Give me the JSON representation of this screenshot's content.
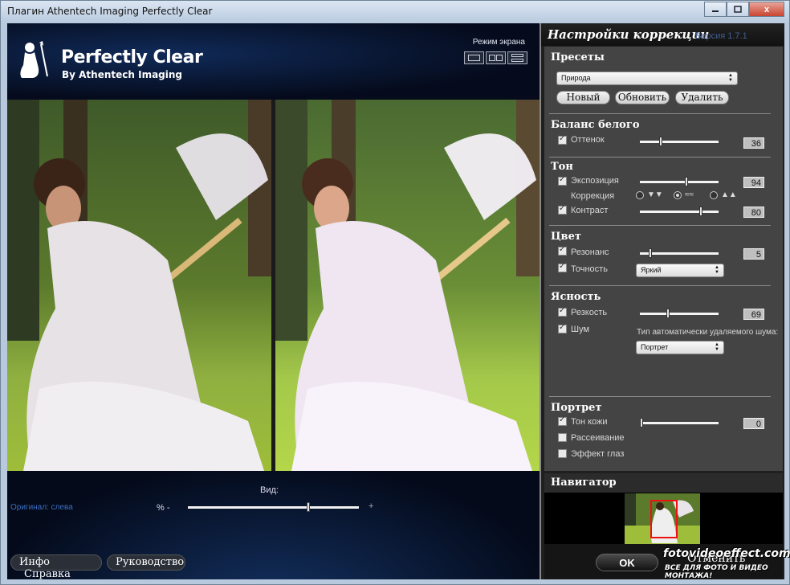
{
  "window": {
    "title": "Плагин Athentech Imaging Perfectly Clear",
    "close": "x"
  },
  "header": {
    "logo_title": "Perfectly Clear",
    "logo_sub": "By Athentech Imaging",
    "mode_label": "Режим экрана"
  },
  "viewbar": {
    "view_label": "Вид:",
    "original_label": "Оригинал: слева",
    "pct_label": "% -",
    "plus_label": "+",
    "view_value": 0.71
  },
  "bottom_buttons": {
    "info": "Инфо",
    "help": "Справка",
    "guide": "Руководство"
  },
  "panel": {
    "title": "Настройки коррекции",
    "version": "Версия 1.7.1"
  },
  "presets": {
    "title": "Пресеты",
    "selected": "Природа",
    "new": "Новый",
    "update": "Обновить",
    "delete": "Удалить"
  },
  "white_balance": {
    "title": "Баланс белого",
    "tint": {
      "label": "Оттенок",
      "value": "36",
      "checked": true,
      "pos": 0.26
    }
  },
  "tone": {
    "title": "Тон",
    "exposure": {
      "label": "Экспозиция",
      "value": "94",
      "checked": true,
      "pos": 0.6
    },
    "correction_label": "Коррекция",
    "radio_low": "▼▼",
    "radio_mid": "≈≈",
    "radio_high": "▲▲",
    "contrast": {
      "label": "Контраст",
      "value": "80",
      "checked": true,
      "pos": 0.79
    }
  },
  "color": {
    "title": "Цвет",
    "resonance": {
      "label": "Резонанс",
      "value": "5",
      "checked": true,
      "pos": 0.12
    },
    "accuracy": {
      "label": "Точность",
      "checked": true,
      "selected": "Яркий"
    }
  },
  "clarity": {
    "title": "Ясность",
    "sharpness": {
      "label": "Резкость",
      "value": "69",
      "checked": true,
      "pos": 0.35
    },
    "noise": {
      "label": "Шум",
      "checked": true
    },
    "noise_type_label": "Тип автоматически удаляемого шума:",
    "noise_type": "Портрет"
  },
  "portrait": {
    "title": "Портрет",
    "skin": {
      "label": "Тон кожи",
      "value": "0",
      "checked": true,
      "pos": 0.0
    },
    "diffusion": {
      "label": "Рассеивание",
      "checked": false
    },
    "eyes": {
      "label": "Эффект глаз",
      "checked": false
    }
  },
  "navigator": {
    "title": "Навигатор"
  },
  "footer": {
    "ok": "OK",
    "cancel": "Отменить",
    "watermark": "fotovideoeffect.com",
    "watermark_sub": "ВСЕ ДЛЯ ФОТО И ВИДЕО МОНТАЖА!"
  },
  "colors": {
    "accent_blue": "#3b6ec4",
    "panel_bg": "#444444",
    "nav_red": "#ee1111"
  }
}
